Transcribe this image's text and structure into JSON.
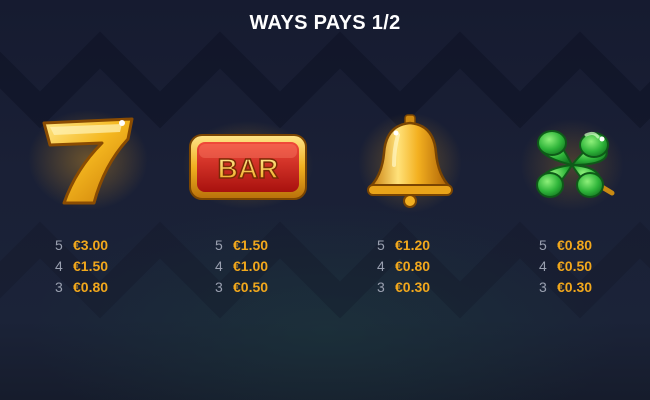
{
  "title": "WAYS PAYS 1/2",
  "symbols": [
    {
      "icon": "seven-icon",
      "pays": [
        {
          "count": "5",
          "amount": "€3.00"
        },
        {
          "count": "4",
          "amount": "€1.50"
        },
        {
          "count": "3",
          "amount": "€0.80"
        }
      ]
    },
    {
      "icon": "bar-icon",
      "label": "BAR",
      "pays": [
        {
          "count": "5",
          "amount": "€1.50"
        },
        {
          "count": "4",
          "amount": "€1.00"
        },
        {
          "count": "3",
          "amount": "€0.50"
        }
      ]
    },
    {
      "icon": "bell-icon",
      "pays": [
        {
          "count": "5",
          "amount": "€1.20"
        },
        {
          "count": "4",
          "amount": "€0.80"
        },
        {
          "count": "3",
          "amount": "€0.30"
        }
      ]
    },
    {
      "icon": "four-leaf-clover-icon",
      "pays": [
        {
          "count": "5",
          "amount": "€0.80"
        },
        {
          "count": "4",
          "amount": "€0.50"
        },
        {
          "count": "3",
          "amount": "€0.30"
        }
      ]
    }
  ],
  "colors": {
    "amount": "#f2a81c",
    "count": "#9aa0b0",
    "background": "#1a2036"
  }
}
